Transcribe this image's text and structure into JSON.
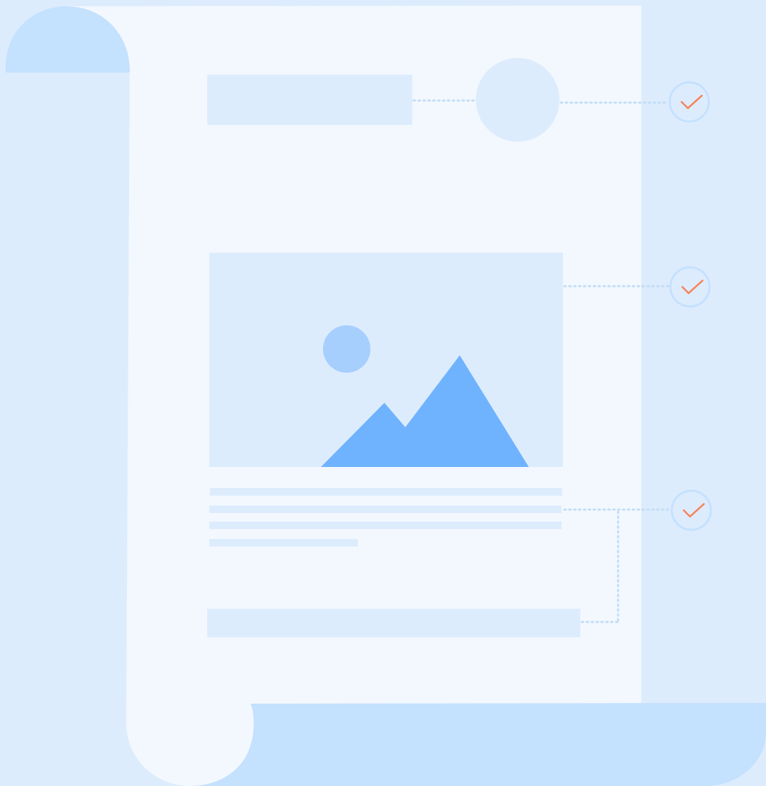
{
  "colors": {
    "background": "#ddecfd",
    "paper": "#f3f8fe",
    "scroll_curl": "#c4e1fe",
    "placeholder_block": "#ddecfd",
    "image_sun": "#a6cffe",
    "image_mountain": "#6fb3fe",
    "connector": "#c2ddf6",
    "check_ring": "#c4e1fe",
    "check_mark": "#f5855c"
  },
  "icons": {
    "image_placeholder": "image-icon",
    "check": "check-icon"
  },
  "checklist": {
    "count": 3,
    "state": "all-checked"
  }
}
